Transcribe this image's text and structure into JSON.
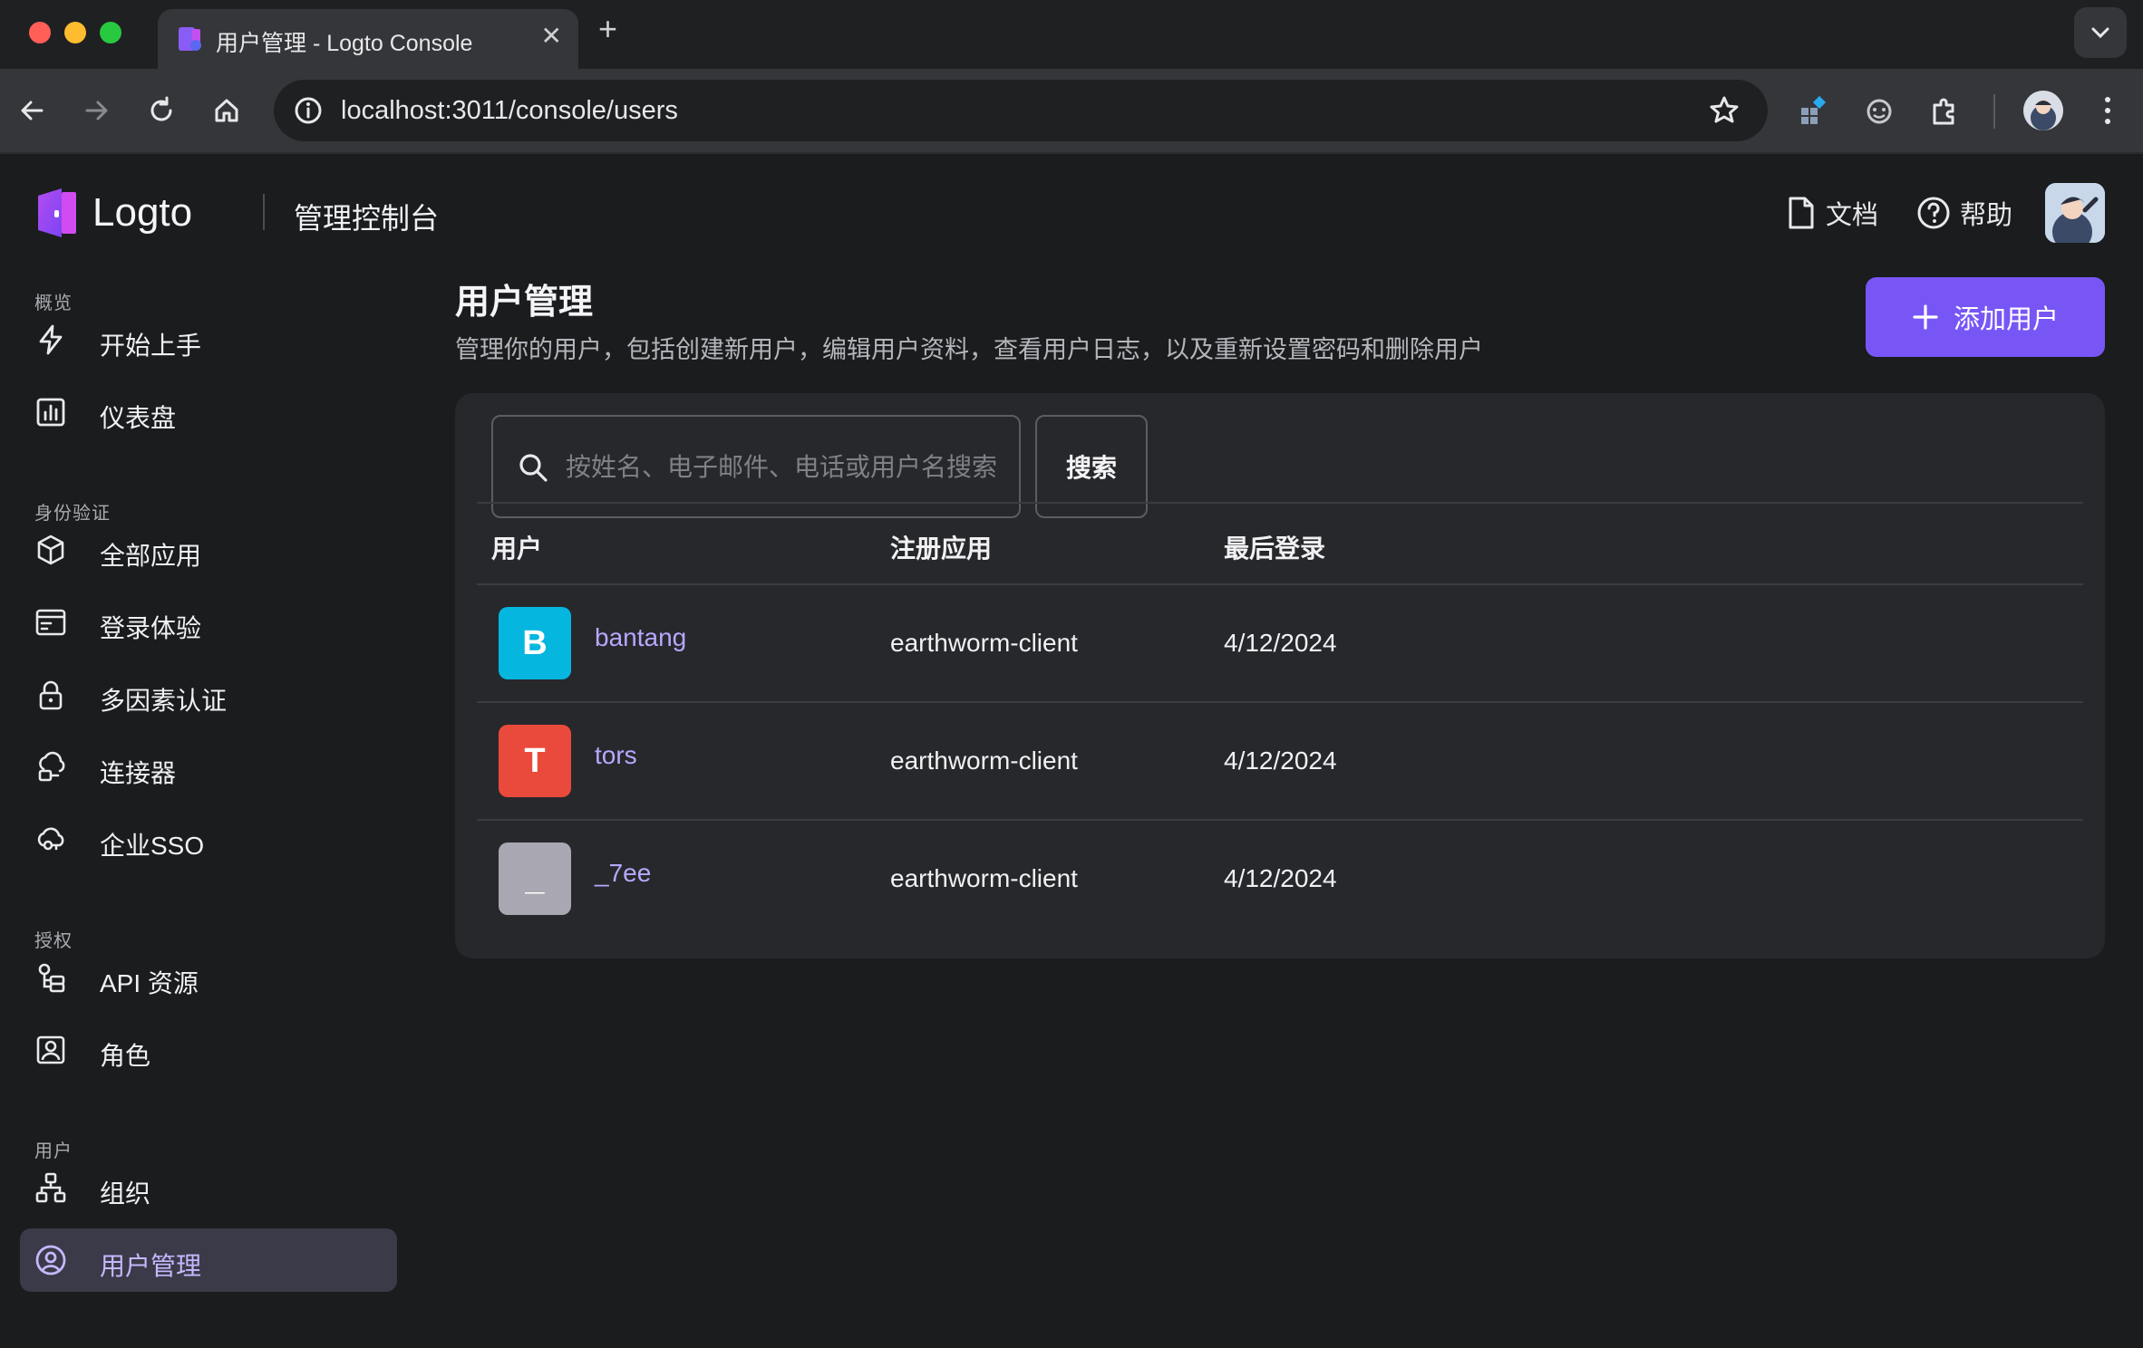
{
  "browser": {
    "tab_title": "用户管理 - Logto Console",
    "tab_close": "✕",
    "new_tab": "+",
    "url": "localhost:3011/console/users"
  },
  "header": {
    "logo_text": "Logto",
    "console_title": "管理控制台",
    "docs_label": "文档",
    "help_label": "帮助"
  },
  "sidebar": {
    "groups": [
      {
        "label": "概览",
        "items": [
          {
            "label": "开始上手",
            "icon": "lightning-icon"
          },
          {
            "label": "仪表盘",
            "icon": "dashboard-icon"
          }
        ]
      },
      {
        "label": "身份验证",
        "items": [
          {
            "label": "全部应用",
            "icon": "box-icon"
          },
          {
            "label": "登录体验",
            "icon": "window-icon"
          },
          {
            "label": "多因素认证",
            "icon": "lock-icon"
          },
          {
            "label": "连接器",
            "icon": "connector-icon"
          },
          {
            "label": "企业SSO",
            "icon": "cloud-key-icon"
          }
        ]
      },
      {
        "label": "授权",
        "items": [
          {
            "label": "API 资源",
            "icon": "api-icon"
          },
          {
            "label": "角色",
            "icon": "role-icon"
          }
        ]
      },
      {
        "label": "用户",
        "items": [
          {
            "label": "组织",
            "icon": "org-icon"
          },
          {
            "label": "用户管理",
            "icon": "user-circle-icon",
            "active": true
          }
        ]
      }
    ]
  },
  "main": {
    "title": "用户管理",
    "subtitle": "管理你的用户，包括创建新用户，编辑用户资料，查看用户日志，以及重新设置密码和删除用户",
    "add_button": "添加用户",
    "search": {
      "placeholder": "按姓名、电子邮件、电话或用户名搜索",
      "value": "",
      "button": "搜索"
    },
    "table": {
      "columns": [
        "用户",
        "注册应用",
        "最后登录"
      ],
      "rows": [
        {
          "initial": "B",
          "name": "bantang",
          "app": "earthworm-client",
          "last_login": "4/12/2024",
          "color": "#05b6de"
        },
        {
          "initial": "T",
          "name": "tors",
          "app": "earthworm-client",
          "last_login": "4/12/2024",
          "color": "#ea4a3b"
        },
        {
          "initial": "_",
          "name": "_7ee",
          "app": "earthworm-client",
          "last_login": "4/12/2024",
          "color": "#a9a8b2"
        }
      ]
    }
  },
  "colors": {
    "accent": "#7856f6",
    "link": "#b7a8ff",
    "active_bg": "#3a3a48"
  }
}
